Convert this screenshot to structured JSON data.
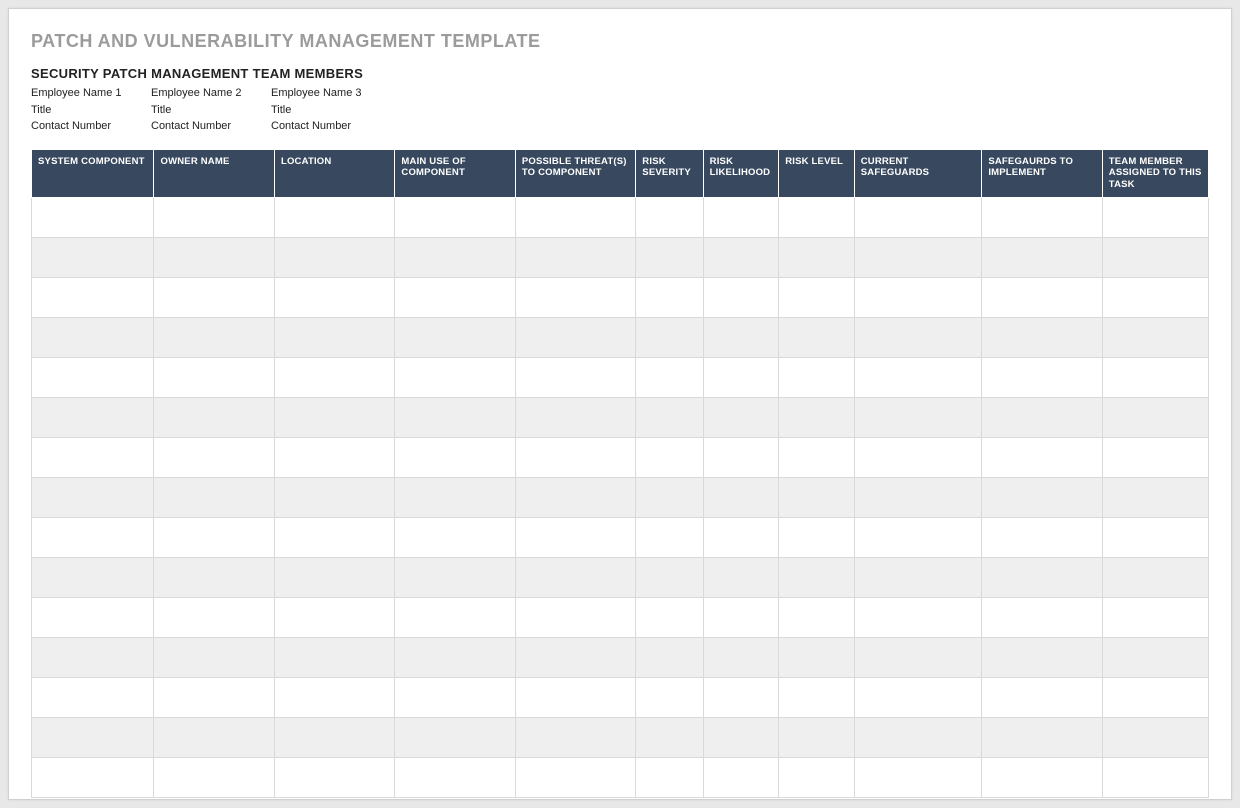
{
  "title": "PATCH AND VULNERABILITY MANAGEMENT TEMPLATE",
  "subtitle": "SECURITY PATCH MANAGEMENT TEAM MEMBERS",
  "team": [
    {
      "name": "Employee Name 1",
      "title": "Title",
      "contact": "Contact Number"
    },
    {
      "name": "Employee Name 2",
      "title": "Title",
      "contact": "Contact Number"
    },
    {
      "name": "Employee Name 3",
      "title": "Title",
      "contact": "Contact Number"
    }
  ],
  "columns": [
    "SYSTEM COMPONENT",
    "OWNER NAME",
    "LOCATION",
    "MAIN USE OF COMPONENT",
    "POSSIBLE THREAT(S) TO COMPONENT",
    "RISK SEVERITY",
    "RISK LIKELIHOOD",
    "RISK LEVEL",
    "CURRENT SAFEGUARDS",
    "SAFEGAURDS TO IMPLEMENT",
    "TEAM MEMBER ASSIGNED TO THIS TASK"
  ],
  "rows": [
    [
      "",
      "",
      "",
      "",
      "",
      "",
      "",
      "",
      "",
      "",
      ""
    ],
    [
      "",
      "",
      "",
      "",
      "",
      "",
      "",
      "",
      "",
      "",
      ""
    ],
    [
      "",
      "",
      "",
      "",
      "",
      "",
      "",
      "",
      "",
      "",
      ""
    ],
    [
      "",
      "",
      "",
      "",
      "",
      "",
      "",
      "",
      "",
      "",
      ""
    ],
    [
      "",
      "",
      "",
      "",
      "",
      "",
      "",
      "",
      "",
      "",
      ""
    ],
    [
      "",
      "",
      "",
      "",
      "",
      "",
      "",
      "",
      "",
      "",
      ""
    ],
    [
      "",
      "",
      "",
      "",
      "",
      "",
      "",
      "",
      "",
      "",
      ""
    ],
    [
      "",
      "",
      "",
      "",
      "",
      "",
      "",
      "",
      "",
      "",
      ""
    ],
    [
      "",
      "",
      "",
      "",
      "",
      "",
      "",
      "",
      "",
      "",
      ""
    ],
    [
      "",
      "",
      "",
      "",
      "",
      "",
      "",
      "",
      "",
      "",
      ""
    ],
    [
      "",
      "",
      "",
      "",
      "",
      "",
      "",
      "",
      "",
      "",
      ""
    ],
    [
      "",
      "",
      "",
      "",
      "",
      "",
      "",
      "",
      "",
      "",
      ""
    ],
    [
      "",
      "",
      "",
      "",
      "",
      "",
      "",
      "",
      "",
      "",
      ""
    ],
    [
      "",
      "",
      "",
      "",
      "",
      "",
      "",
      "",
      "",
      "",
      ""
    ],
    [
      "",
      "",
      "",
      "",
      "",
      "",
      "",
      "",
      "",
      "",
      ""
    ]
  ]
}
